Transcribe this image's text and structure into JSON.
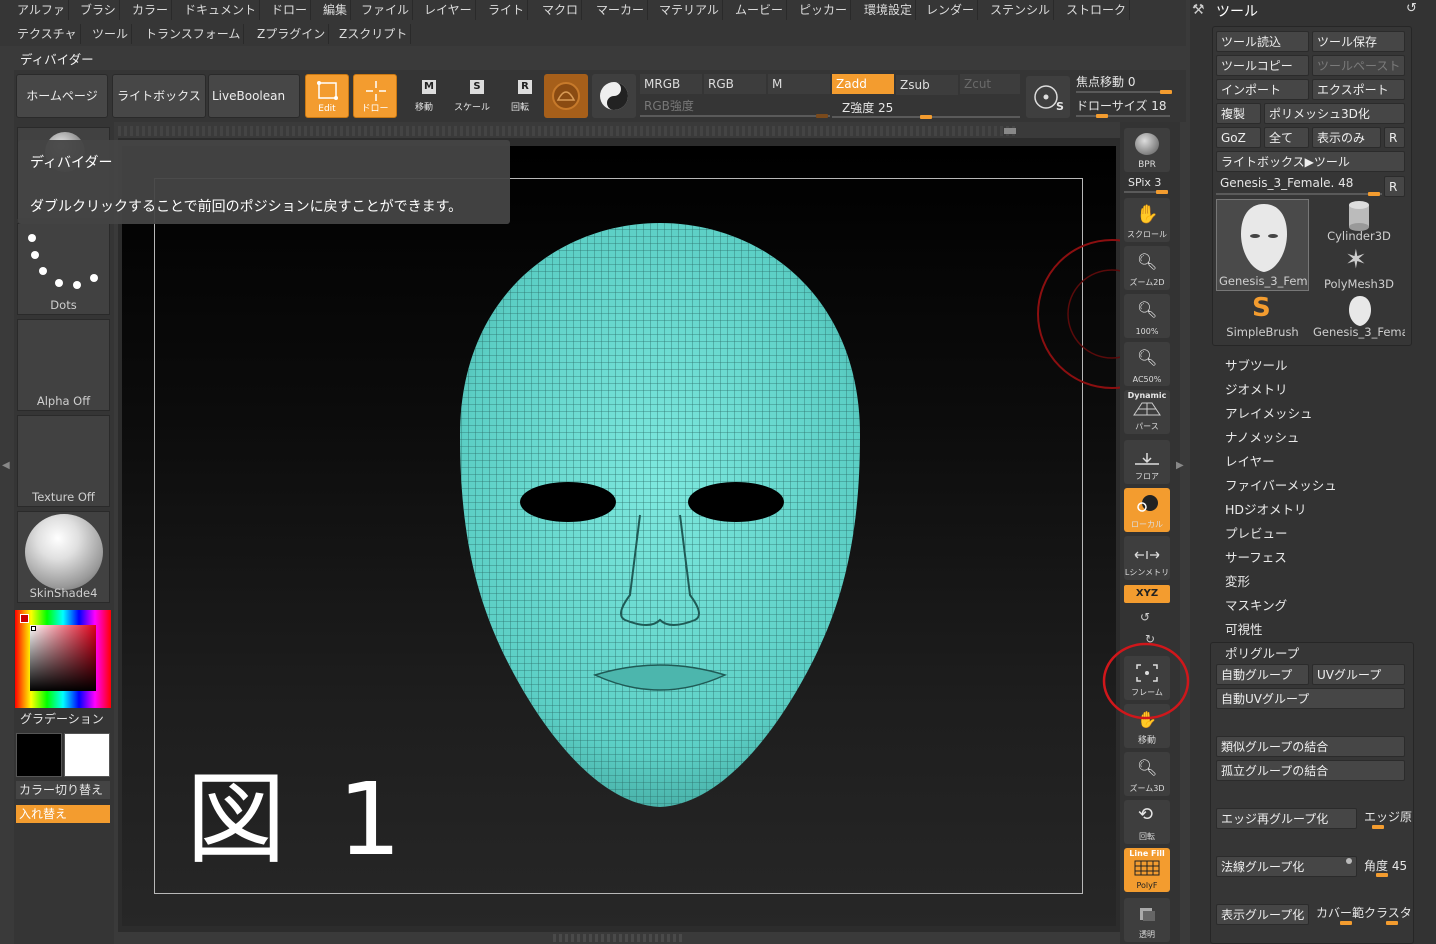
{
  "menu": {
    "row1": [
      "アルファ",
      "ブラシ",
      "カラー",
      "ドキュメント",
      "ドロー",
      "編集",
      "ファイル",
      "レイヤー",
      "ライト",
      "マクロ",
      "マーカー",
      "マテリアル",
      "ムービー",
      "ピッカー",
      "環境設定",
      "レンダー",
      "ステンシル",
      "ストローク"
    ],
    "row2": [
      "テクスチャ",
      "ツール",
      "トランスフォーム",
      "Zプラグイン",
      "Zスクリプト"
    ]
  },
  "palette_title": "ディバイダー",
  "tooltip": {
    "title": "ディバイダー",
    "body": "ダブルクリックすることで前回のポジションに戻すことができます。"
  },
  "top_shelf": {
    "home": "ホームページ",
    "lightbox": "ライトボックス",
    "liveboolean": "LiveBoolean",
    "edit": "Edit",
    "draw": "ドロー",
    "move_letter": "M",
    "move": "移動",
    "scale_letter": "S",
    "scale": "スケール",
    "rotate_letter": "R",
    "rotate": "回転",
    "mrgb": "MRGB",
    "rgb": "RGB",
    "m": "M",
    "zadd": "Zadd",
    "zsub": "Zsub",
    "zcut": "Zcut",
    "rgb_intensity": "RGB強度",
    "z_intensity": "Z強度 25",
    "focal_shift": "焦点移動 0",
    "draw_size": "ドローサイズ 18",
    "s_badge": "S"
  },
  "left_panel": {
    "dots": "Dots",
    "alpha": "Alpha Off",
    "texture": "Texture Off",
    "material": "SkinShade4",
    "gradient": "グラデーション",
    "color_switch": "カラー切り替え",
    "swap": "入れ替え"
  },
  "canvas": {
    "figure_label": "図 1"
  },
  "right_shelf": {
    "bpr": "BPR",
    "spix": "SPix 3",
    "scroll": "スクロール",
    "zoom2d": "ズーム2D",
    "hundred": "100%",
    "ac50": "AC50%",
    "dynamic": "Dynamic",
    "perspective": "パース",
    "floor": "フロア",
    "local": "ローカル",
    "lsym": "Lシンメトリ",
    "xyz": "XYZ",
    "frame": "フレーム",
    "move": "移動",
    "zoom3d": "ズーム3D",
    "rotate": "回転",
    "linefill": "Line Fill",
    "polyf": "PolyF",
    "transparent": "透明"
  },
  "tool_panel": {
    "title": "ツール",
    "load": "ツール読込",
    "save": "ツール保存",
    "copy": "ツールコピー",
    "paste": "ツールペースト",
    "import": "インポート",
    "export": "エクスポート",
    "clone": "複製",
    "polymesh": "ポリメッシュ3D化",
    "goz": "GoZ",
    "all": "全て",
    "visible": "表示のみ",
    "r": "R",
    "lightbox_tool": "ライトボックス▶ツール",
    "current_tool": "Genesis_3_Female. 48",
    "thumbs": [
      "Genesis_3_Fema",
      "Cylinder3D",
      "PolyMesh3D",
      "SimpleBrush",
      "Genesis_3_Fema"
    ],
    "subpalettes": [
      "サブツール",
      "ジオメトリ",
      "アレイメッシュ",
      "ナノメッシュ",
      "レイヤー",
      "ファイバーメッシュ",
      "HDジオメトリ",
      "プレビュー",
      "サーフェス",
      "変形",
      "マスキング",
      "可視性"
    ],
    "polygroups": "ポリグループ",
    "auto_groups": "自動グループ",
    "uv_groups": "UVグループ",
    "auto_uv_groups": "自動UVグループ",
    "merge_similar": "類似グループの結合",
    "merge_isolated": "孤立グループの結合",
    "edge_regroup": "エッジ再グループ化",
    "edge_short": "エッジ原",
    "normal_groups": "法線グループ化",
    "angle": "角度 45",
    "visible_groups": "表示グループ化",
    "coverage": "カバー範",
    "cluster": "クラスタ"
  },
  "colors": {
    "accent": "#f39c2f",
    "mesh": "#5fd3c9",
    "annotation": "#d0171b"
  }
}
